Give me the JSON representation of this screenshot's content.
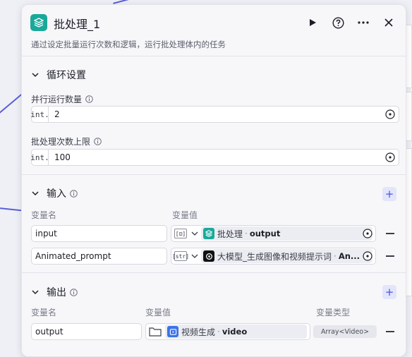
{
  "header": {
    "title": "批处理_1",
    "description": "通过设定批量运行次数和逻辑，运行批处理体内的任务"
  },
  "loop_settings": {
    "section_title": "循环设置",
    "parallel": {
      "label": "并行运行数量",
      "type_prefix": "int.",
      "value": "2"
    },
    "max_batch": {
      "label": "批处理次数上限",
      "type_prefix": "int.",
      "value": "100"
    }
  },
  "input": {
    "section_title": "输入",
    "col_name": "变量名",
    "col_value": "变量值",
    "rows": [
      {
        "name": "input",
        "type_tag": "[⊡]",
        "source": "批处理",
        "sep": "·",
        "var": "output"
      },
      {
        "name": "Animated_prompt",
        "type_tag": "[str]",
        "source": "大模型_生成图像和视频提示词",
        "sep": "·",
        "var": "An..."
      }
    ]
  },
  "output": {
    "section_title": "输出",
    "col_name": "变量名",
    "col_value": "变量值",
    "col_type": "变量类型",
    "rows": [
      {
        "name": "output",
        "source": "视频生成",
        "sep": "·",
        "var": "video",
        "type": "Array<Video>"
      }
    ]
  },
  "colors": {
    "accent": "#4c55d9",
    "teal": "#19a99a",
    "video_blue": "#3b73e8"
  }
}
